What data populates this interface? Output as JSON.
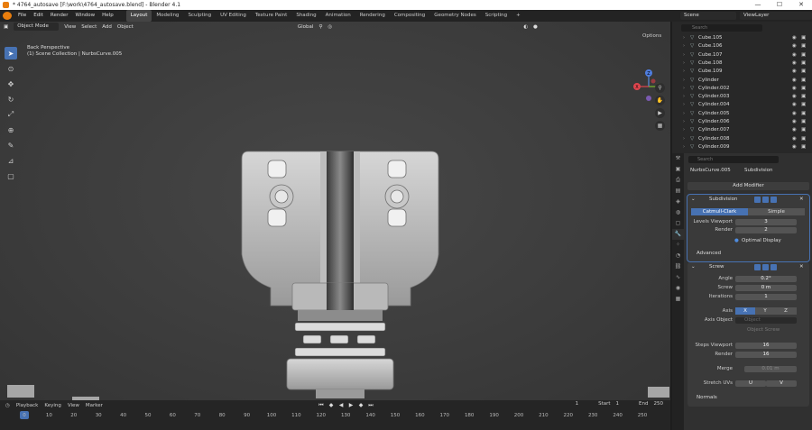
{
  "window": {
    "title": "* 4764_autosave [F:\\work\\4764_autosave.blend] - Blender 4.1",
    "controls": [
      "—",
      "☐",
      "✕"
    ]
  },
  "menubar": {
    "menus": [
      "File",
      "Edit",
      "Render",
      "Window",
      "Help"
    ],
    "workspaces": [
      "Layout",
      "Modeling",
      "Sculpting",
      "UV Editing",
      "Texture Paint",
      "Shading",
      "Animation",
      "Rendering",
      "Compositing",
      "Geometry Nodes",
      "Scripting"
    ],
    "active_workspace": "Layout",
    "scene": "Scene",
    "view_layer": "ViewLayer"
  },
  "viewport": {
    "mode": "Object Mode",
    "menus": [
      "View",
      "Select",
      "Add",
      "Object"
    ],
    "transform_orientation": "Global",
    "view_name": "Back Perspective",
    "collection_info": "(1) Scene Collection | NurbsCurve.005",
    "options_label": "Options",
    "gizmo_axes": {
      "x": "X",
      "y": "Y",
      "z": "Z"
    }
  },
  "timeline": {
    "menus": [
      "Playback",
      "Keying",
      "View",
      "Marker"
    ],
    "ticks": [
      "0",
      "10",
      "20",
      "30",
      "40",
      "50",
      "60",
      "70",
      "80",
      "90",
      "100",
      "110",
      "120",
      "130",
      "140",
      "150",
      "160",
      "170",
      "180",
      "190",
      "200",
      "210",
      "220",
      "230",
      "240",
      "250"
    ],
    "current_frame": "1",
    "start_label": "Start",
    "start": "1",
    "end_label": "End",
    "end": "250",
    "playhead": "1"
  },
  "outliner": {
    "search_placeholder": "Search",
    "items": [
      {
        "name": "Cube.105"
      },
      {
        "name": "Cube.106"
      },
      {
        "name": "Cube.107"
      },
      {
        "name": "Cube.108"
      },
      {
        "name": "Cube.109"
      },
      {
        "name": "Cylinder"
      },
      {
        "name": "Cylinder.002"
      },
      {
        "name": "Cylinder.003"
      },
      {
        "name": "Cylinder.004"
      },
      {
        "name": "Cylinder.005"
      },
      {
        "name": "Cylinder.006"
      },
      {
        "name": "Cylinder.007"
      },
      {
        "name": "Cylinder.008"
      },
      {
        "name": "Cylinder.009"
      }
    ]
  },
  "properties": {
    "search_placeholder": "Search",
    "object": "NurbsCurve.005",
    "modifier_breadcrumb": "Subdivision",
    "add_modifier": "Add Modifier",
    "subdivision": {
      "name": "Subdivision",
      "mode_catmull": "Catmull-Clark",
      "mode_simple": "Simple",
      "levels_viewport_label": "Levels Viewport",
      "levels_viewport": "3",
      "render_label": "Render",
      "render": "2",
      "optimal_display": "Optimal Display",
      "advanced": "Advanced"
    },
    "screw": {
      "name": "Screw",
      "angle_label": "Angle",
      "angle": "0.2°",
      "screw_label": "Screw",
      "screw": "0 m",
      "iterations_label": "Iterations",
      "iterations": "1",
      "axis_label": "Axis",
      "axis": [
        "X",
        "Y",
        "Z"
      ],
      "axis_object_label": "Axis Object",
      "axis_object_placeholder": "Object",
      "object_screw": "Object Screw",
      "steps_viewport_label": "Steps Viewport",
      "steps_viewport": "16",
      "steps_render_label": "Render",
      "steps_render": "16",
      "merge_label": "Merge",
      "merge": "0.01 m",
      "stretch_uvs_label": "Stretch UVs",
      "stretch_u": "U",
      "stretch_v": "V",
      "normals": "Normals"
    }
  }
}
